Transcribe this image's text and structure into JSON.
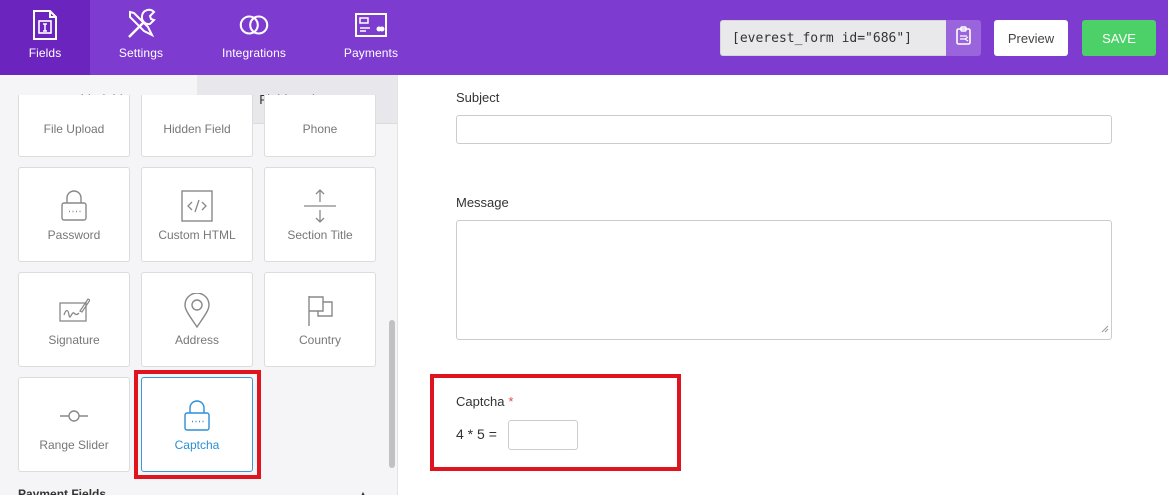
{
  "topbar": {
    "nav": [
      {
        "label": "Fields",
        "icon": "fields-icon"
      },
      {
        "label": "Settings",
        "icon": "settings-tools-icon"
      },
      {
        "label": "Integrations",
        "icon": "integrations-rings-icon"
      },
      {
        "label": "Payments",
        "icon": "payments-card-icon"
      }
    ],
    "shortcode": "[everest_form id=\"686\"]",
    "preview_label": "Preview",
    "save_label": "SAVE",
    "colors": {
      "bar": "#7e3bd0",
      "active": "#6b24be",
      "save": "#4cd169"
    }
  },
  "left_panel": {
    "tabs": [
      {
        "label": "Add Fields"
      },
      {
        "label": "Field Options"
      }
    ],
    "fields": [
      {
        "label": "File Upload"
      },
      {
        "label": "Hidden Field"
      },
      {
        "label": "Phone"
      },
      {
        "label": "Password",
        "icon": "lock-icon"
      },
      {
        "label": "Custom HTML",
        "icon": "code-icon"
      },
      {
        "label": "Section Title",
        "icon": "section-arrows-icon"
      },
      {
        "label": "Signature",
        "icon": "signature-icon"
      },
      {
        "label": "Address",
        "icon": "map-pin-icon"
      },
      {
        "label": "Country",
        "icon": "flag-icon"
      },
      {
        "label": "Range Slider",
        "icon": "range-slider-icon"
      },
      {
        "label": "Captcha",
        "icon": "lock-icon",
        "selected": true
      }
    ],
    "next_section": "Payment Fields"
  },
  "form": {
    "subject_label": "Subject",
    "message_label": "Message",
    "captcha_label": "Captcha",
    "required_mark": "*",
    "captcha_question": "4 * 5 ="
  }
}
